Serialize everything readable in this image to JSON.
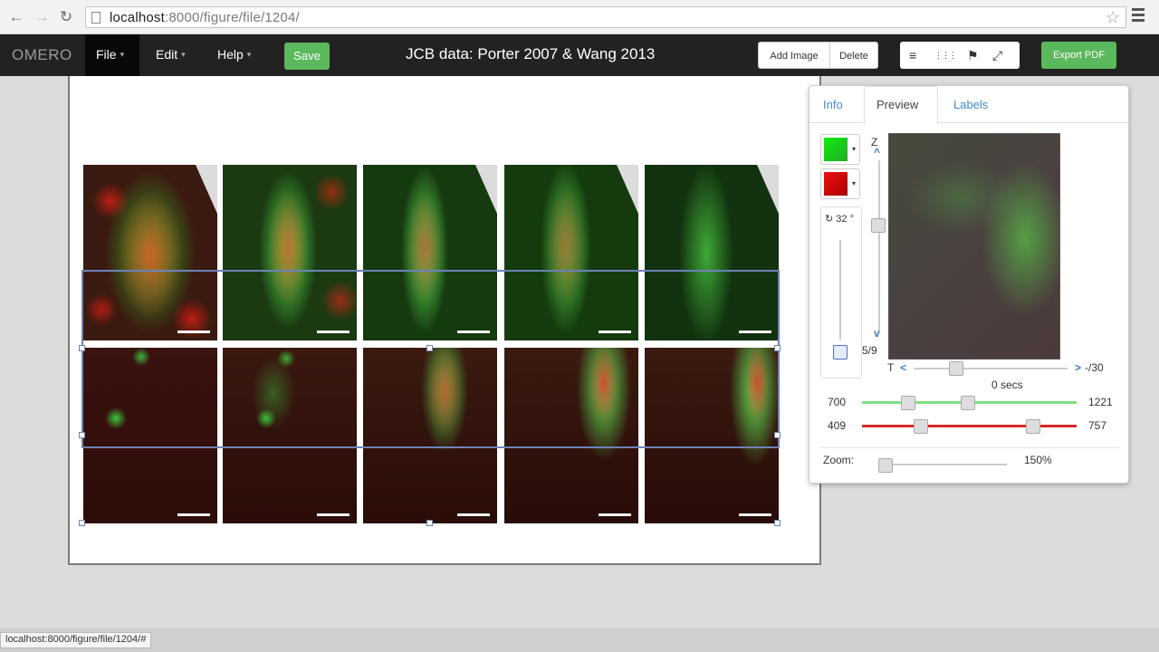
{
  "browser": {
    "url_host": "localhost",
    "url_rest": ":8000/figure/file/1204/",
    "back_glyph": "←",
    "forward_glyph": "→",
    "reload_glyph": "↻",
    "star_glyph": "☆"
  },
  "app": {
    "brand": "OMERO",
    "menus": [
      {
        "label": "File"
      },
      {
        "label": "Edit"
      },
      {
        "label": "Help"
      }
    ],
    "caret": "▾",
    "save_label": "Save",
    "figure_title": "JCB data: Porter 2007 & Wang 2013",
    "add_image_label": "Add Image",
    "delete_label": "Delete",
    "export_label": "Export PDF",
    "layout_icons": [
      "align-left-icon",
      "grid-icon",
      "flag-icon",
      "expand-icon"
    ],
    "layout_glyphs": [
      "≡",
      "⋮⋮⋮",
      "⚑",
      "⤢"
    ]
  },
  "panel_side": {
    "tabs": [
      {
        "label": "Info",
        "active": false
      },
      {
        "label": "Preview",
        "active": true
      },
      {
        "label": "Labels",
        "active": false
      }
    ],
    "channels": [
      {
        "name": "green",
        "color": "#22dd22"
      },
      {
        "name": "red",
        "color": "#dd0000"
      }
    ],
    "rotation": "↻ 32 °",
    "z_label": "Z",
    "z_value": "5/9",
    "t_label": "T",
    "t_value": "-/30",
    "time_text": "0 secs",
    "green_min": "700",
    "green_max": "1221",
    "red_min": "409",
    "red_max": "757",
    "zoom_label": "Zoom:",
    "zoom_value": "150%"
  },
  "status": {
    "link": "localhost:8000/figure/file/1204/#"
  },
  "colors": {
    "accent_green": "#5cb85c",
    "tab_link": "#428bca",
    "selection": "#6d82b8"
  }
}
